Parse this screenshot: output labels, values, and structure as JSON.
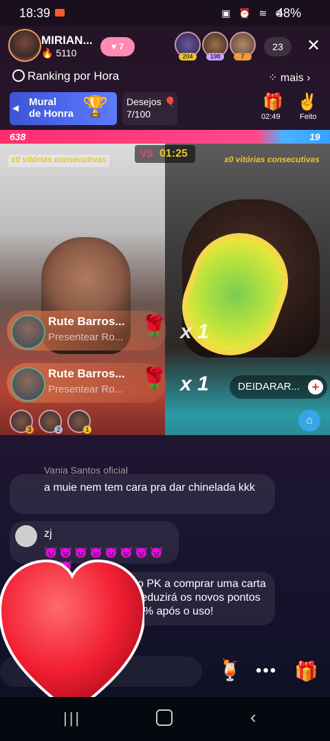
{
  "status_bar": {
    "time": "18:39",
    "battery": "48%"
  },
  "header": {
    "host_name": "MIRIAN...",
    "host_fans": "5110",
    "follow_badge": "7",
    "viewers": [
      {
        "badge": "204"
      },
      {
        "badge": "198"
      },
      {
        "badge": "7"
      }
    ],
    "viewer_count": "23"
  },
  "ranking": {
    "label": "Ranking por Hora",
    "more_label": "mais"
  },
  "mural": {
    "title_line1": "Mural",
    "title_line2": "de Honra"
  },
  "desejos": {
    "label": "Desejos",
    "count": "7/100"
  },
  "gift_box": {
    "timer": "02:49"
  },
  "feito": {
    "label": "Feito"
  },
  "pk": {
    "left_score": "638",
    "right_score": "19",
    "timer": "01:25",
    "vs": "VS",
    "left_streak": "x0 vitórias consecutivas",
    "right_streak": "x0 vitórias consecutivas"
  },
  "gifts": [
    {
      "name": "Rute Barros...",
      "sub": "Presentear Ro...",
      "mult": "x 1"
    },
    {
      "name": "Rute Barros...",
      "sub": "Presentear Ro...",
      "mult": "x 1"
    }
  ],
  "follow_pill": {
    "name": "DEIDARAR..."
  },
  "top_gifters": [
    {
      "rank": "3"
    },
    {
      "rank": "2"
    },
    {
      "rank": "1"
    }
  ],
  "chat": {
    "partial_name": "Vania Santos oficial",
    "msg1": "a muie nem tem cara pra dar chinelada kkk",
    "msg2_name": "zj",
    "msg2_emoji": "😈😈😈😈😈😈😈😈😈😈",
    "msg3": "o PK a comprar uma carta reduzirá os novos pontos 0% após o uso!"
  },
  "colors": {
    "pk_red": "#ff2e6e",
    "pk_blue": "#38a0ff",
    "accent_pink": "#ff8ab3",
    "heart": "#ff2b3c"
  }
}
